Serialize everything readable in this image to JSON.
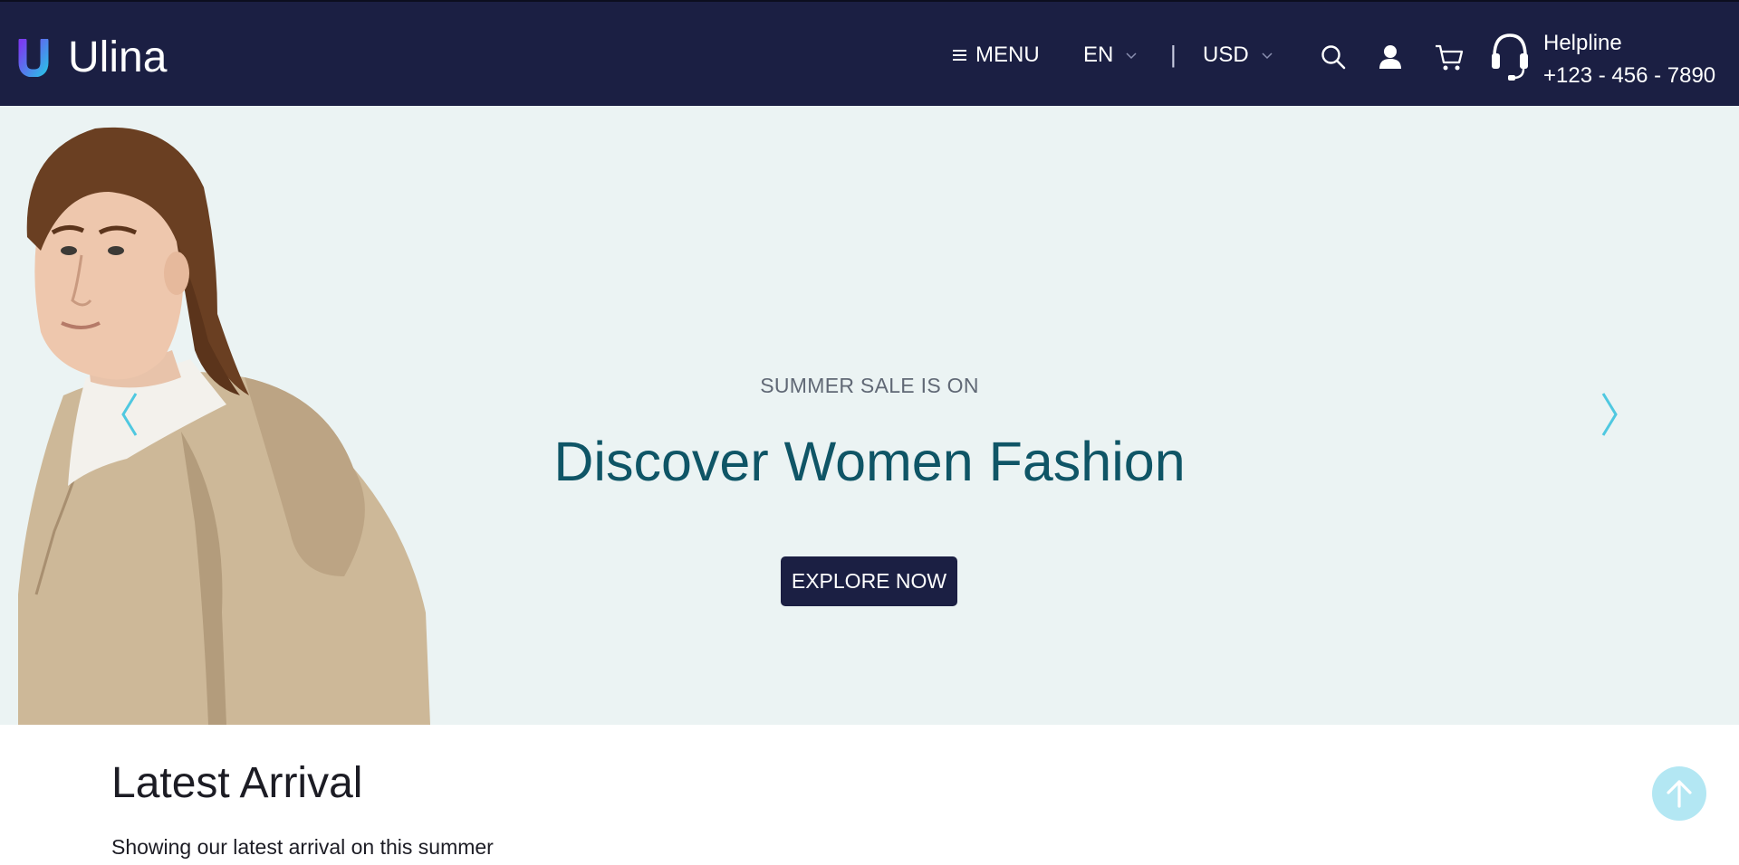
{
  "header": {
    "brand": "Ulina",
    "menu_label": "MENU",
    "language": "EN",
    "divider": "|",
    "currency": "USD",
    "helpline_label": "Helpline",
    "helpline_number": "+123 - 456 - 7890",
    "icons": [
      "logo-icon",
      "menu-icon",
      "chevron-down-icon",
      "search-icon",
      "user-icon",
      "cart-icon",
      "headset-icon"
    ]
  },
  "hero": {
    "subtitle": "SUMMER SALE IS ON",
    "title": "Discover Women Fashion",
    "cta_label": "EXPLORE NOW",
    "icons": [
      "chevron-left-icon",
      "chevron-right-icon"
    ]
  },
  "latest": {
    "title": "Latest Arrival",
    "subtitle": "Showing our latest arrival on this summer"
  },
  "colors": {
    "header_bg": "#1b1f43",
    "hero_bg": "#ebf3f3",
    "title_color": "#0f5566",
    "arrow_color": "#4fc8e0",
    "to_top_bg": "#b3e7f3"
  }
}
